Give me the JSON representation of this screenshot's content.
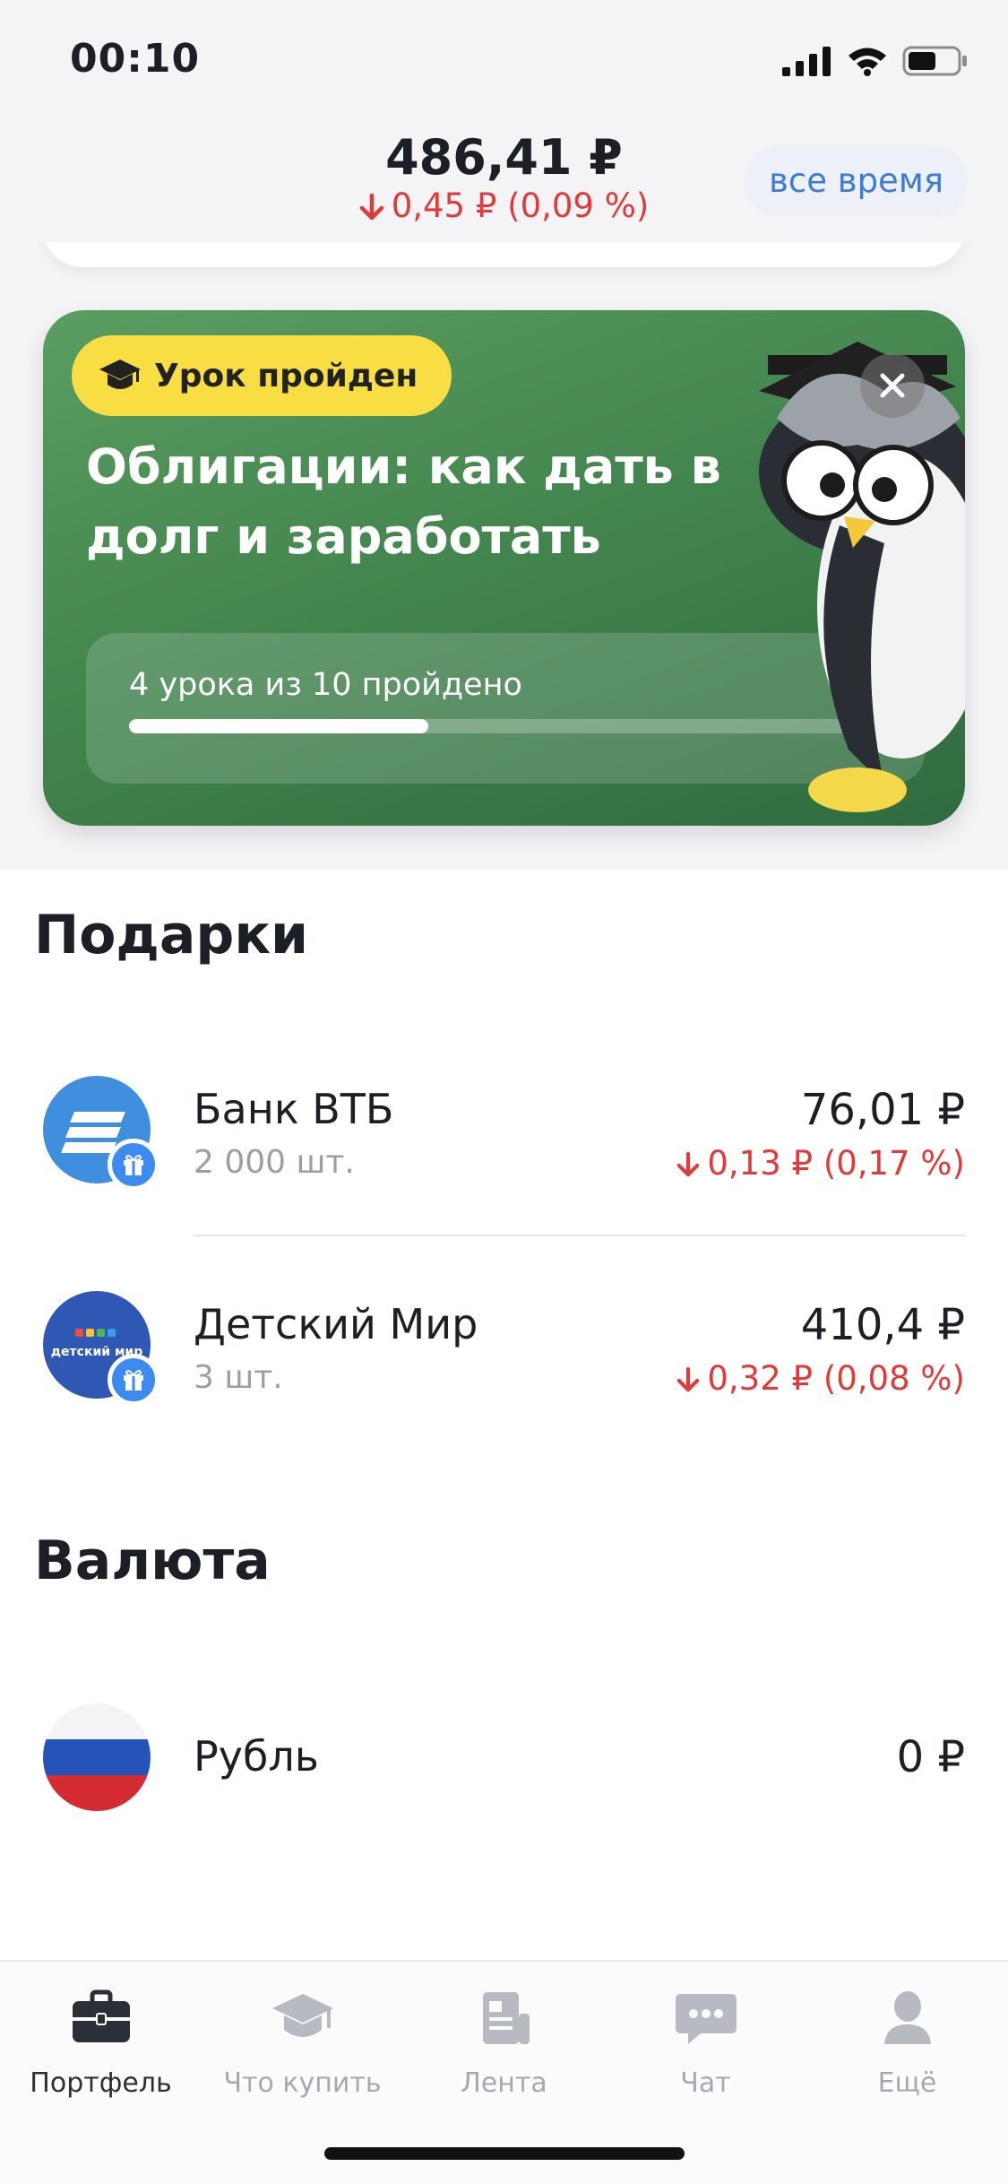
{
  "status_bar": {
    "time": "00:10"
  },
  "header": {
    "price": "486,41 ₽",
    "change": "0,45 ₽ (0,09 %)",
    "period_button": "все время"
  },
  "lesson_card": {
    "badge": "Урок пройден",
    "title": "Облигации: как дать в долг и заработать",
    "progress_text": "4 урока из 10 пройдено",
    "progress_fraction": 0.4
  },
  "gifts": {
    "title": "Подарки",
    "items": [
      {
        "name": "Банк ВТБ",
        "quantity": "2 000 шт.",
        "value": "76,01 ₽",
        "change": "0,13 ₽ (0,17 %)"
      },
      {
        "name": "Детский Мир",
        "quantity": "3 шт.",
        "value": "410,4 ₽",
        "change": "0,32 ₽ (0,08 %)",
        "logo_text": "детский мир"
      }
    ]
  },
  "currency": {
    "title": "Валюта",
    "items": [
      {
        "name": "Рубль",
        "value": "0 ₽"
      }
    ]
  },
  "tab_bar": {
    "tabs": [
      {
        "label": "Портфель",
        "icon": "briefcase-icon",
        "active": true
      },
      {
        "label": "Что купить",
        "icon": "graduation-cap-icon",
        "active": false
      },
      {
        "label": "Лента",
        "icon": "feed-icon",
        "active": false
      },
      {
        "label": "Чат",
        "icon": "chat-icon",
        "active": false
      },
      {
        "label": "Ещё",
        "icon": "profile-icon",
        "active": false
      }
    ]
  },
  "colors": {
    "negative": "#e03a3a",
    "accent_blue": "#3e7ad6",
    "badge_yellow": "#f8de43",
    "card_green": "#44864f"
  }
}
